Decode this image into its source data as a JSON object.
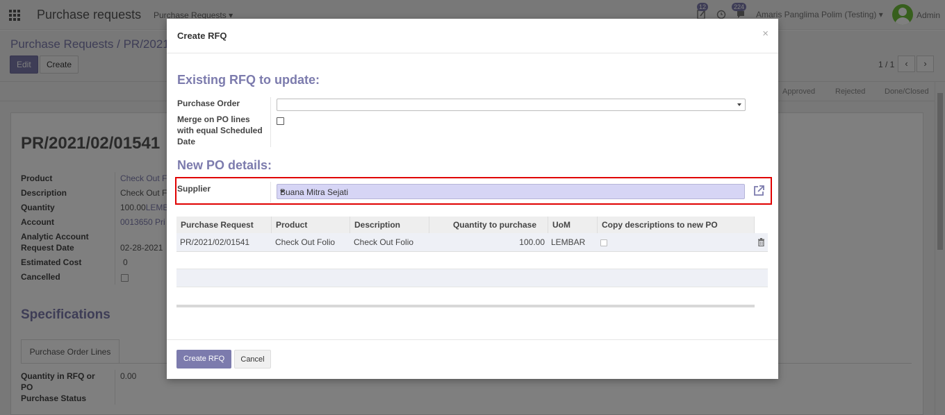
{
  "navbar": {
    "app_title": "Purchase requests",
    "menu": "Purchase Requests",
    "activity_count": "12",
    "message_count": "224",
    "company": "Amaris Panglima Polim (Testing)",
    "user": "Admin"
  },
  "control_panel": {
    "breadcrumb_parent": "Purchase Requests",
    "breadcrumb_separator": "/",
    "breadcrumb_current": "PR/2021/",
    "edit_label": "Edit",
    "create_label": "Create",
    "pager": "1 / 1"
  },
  "status_stages": [
    "Approved",
    "Rejected",
    "Done/Closed"
  ],
  "record": {
    "title": "PR/2021/02/01541",
    "fields": [
      {
        "label": "Product",
        "value": "Check Out F",
        "link": true
      },
      {
        "label": "Description",
        "value": "Check Out F"
      },
      {
        "label": "Quantity",
        "value": "100.00",
        "extra": "LEMB"
      },
      {
        "label": "Account",
        "value": "0013650 Pri",
        "link": true
      },
      {
        "label": "Analytic Account",
        "value": ""
      },
      {
        "label": "Request Date",
        "value": "02-28-2021"
      },
      {
        "label": "Estimated Cost",
        "value": "0"
      },
      {
        "label": "Cancelled",
        "value": ""
      }
    ],
    "specifications_title": "Specifications",
    "tab_label": "Purchase Order Lines",
    "qty_label_1": "Quantity in RFQ or",
    "qty_label_2": "PO",
    "qty_value": "0.00",
    "purchase_status_label": "Purchase Status"
  },
  "modal": {
    "title": "Create RFQ",
    "close": "×",
    "existing_section": "Existing RFQ to update:",
    "purchase_order_label": "Purchase Order",
    "purchase_order_value": "",
    "merge_label_1": "Merge on PO lines",
    "merge_label_2": "with equal Scheduled",
    "merge_label_3": "Date",
    "new_section": "New PO details:",
    "supplier_label": "Supplier",
    "supplier_value": "Buana Mitra Sejati",
    "table": {
      "headers": [
        "Purchase Request",
        "Product",
        "Description",
        "Quantity to purchase",
        "UoM",
        "Copy descriptions to new PO"
      ],
      "rows": [
        {
          "request": "PR/2021/02/01541",
          "product": "Check Out Folio",
          "description": "Check Out Folio",
          "quantity": "100.00",
          "uom": "LEMBAR",
          "copy": false
        }
      ]
    },
    "create_button": "Create RFQ",
    "cancel_button": "Cancel"
  },
  "colors": {
    "brand": "#7c7bad",
    "supplier_fill": "#d6d5f5",
    "highlight": "#e00000"
  }
}
